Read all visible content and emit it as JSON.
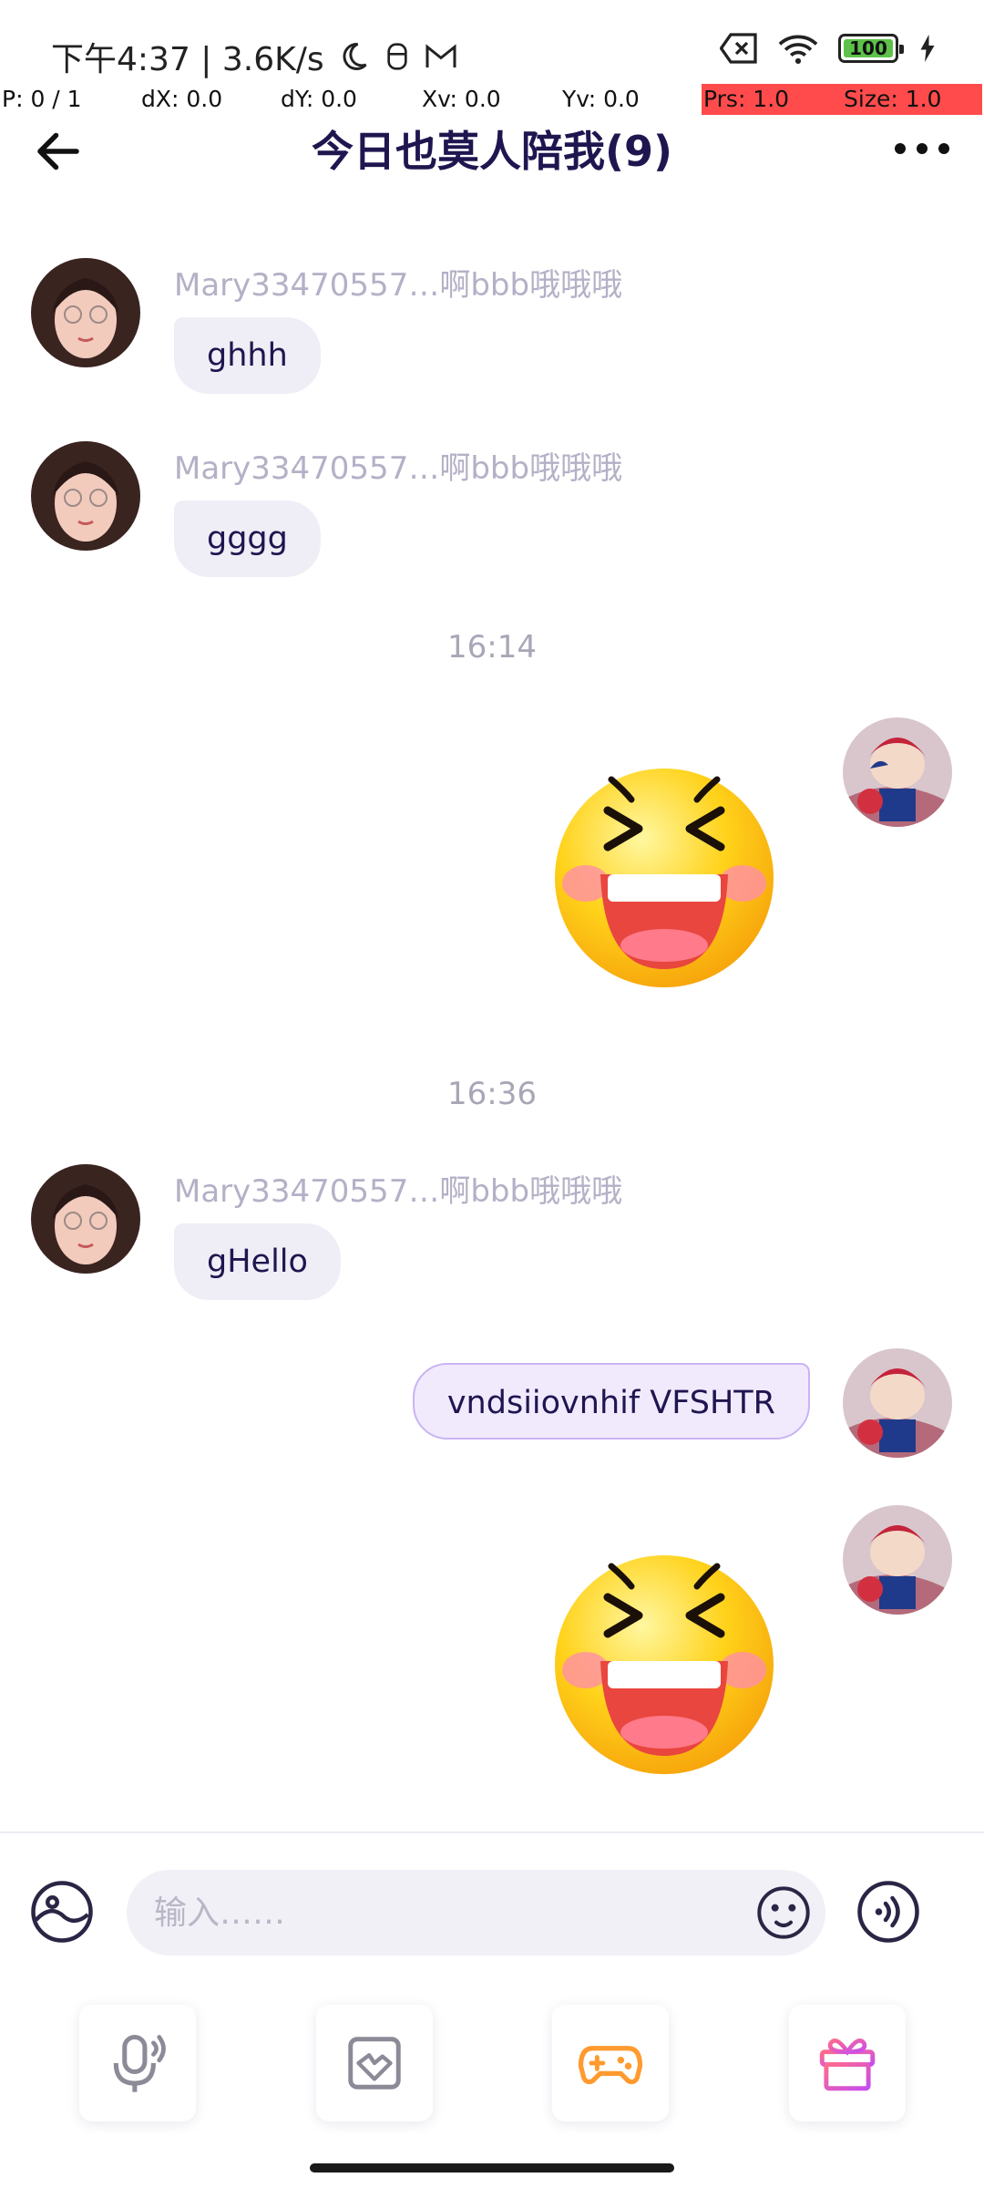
{
  "status_bar": {
    "time_speed": "下午4:37 | 3.6K/s",
    "battery": "100"
  },
  "pointer_debug": {
    "p": "P: 0 / 1",
    "dx": "dX: 0.0",
    "dy": "dY: 0.0",
    "xv": "Xv: 0.0",
    "yv": "Yv: 0.0",
    "prs": "Prs: 1.0",
    "size": "Size: 1.0"
  },
  "header": {
    "title": "今日也莫人陪我(9)"
  },
  "messages": [
    {
      "sender": "Mary33470557…啊bbb哦哦哦",
      "text": "ghhh"
    },
    {
      "sender": "Mary33470557…啊bbb哦哦哦",
      "text": "gggg"
    },
    {
      "time": "16:14"
    },
    {
      "time": "16:36"
    },
    {
      "sender": "Mary33470557…啊bbb哦哦哦",
      "text": "gHello"
    },
    {
      "text": "vndsiiovnhif VFSHTR"
    }
  ],
  "input": {
    "placeholder": "输入……"
  },
  "colors": {
    "accent": "#c9b4f4",
    "title": "#1f1650",
    "game": "#ff9a2e",
    "gift": "#e85cc8"
  }
}
